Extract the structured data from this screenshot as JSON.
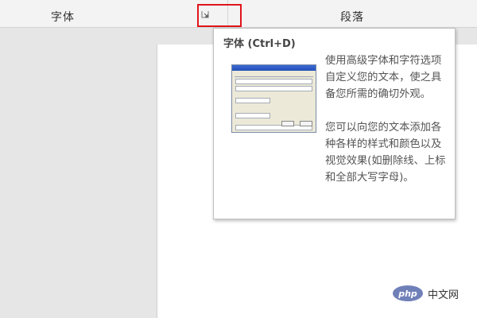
{
  "ribbon": {
    "font_group_label": "字体",
    "paragraph_group_label": "段落",
    "launcher_icon": "dialog-launcher-icon"
  },
  "colors": {
    "highlight": "#e0141b",
    "ribbon_bg": "#f3f3f3",
    "workspace_bg": "#e6e6e6"
  },
  "tooltip": {
    "title": "字体 (Ctrl+D)",
    "description_1": "使用高级字体和字符选项自定义您的文本，使之具备您所需的确切外观。",
    "description_2": "您可以向您的文本添加各种各样的样式和颜色以及视觉效果(如删除线、上标和全部大写字母)。"
  },
  "watermark": {
    "logo": "php",
    "text": "中文网"
  }
}
